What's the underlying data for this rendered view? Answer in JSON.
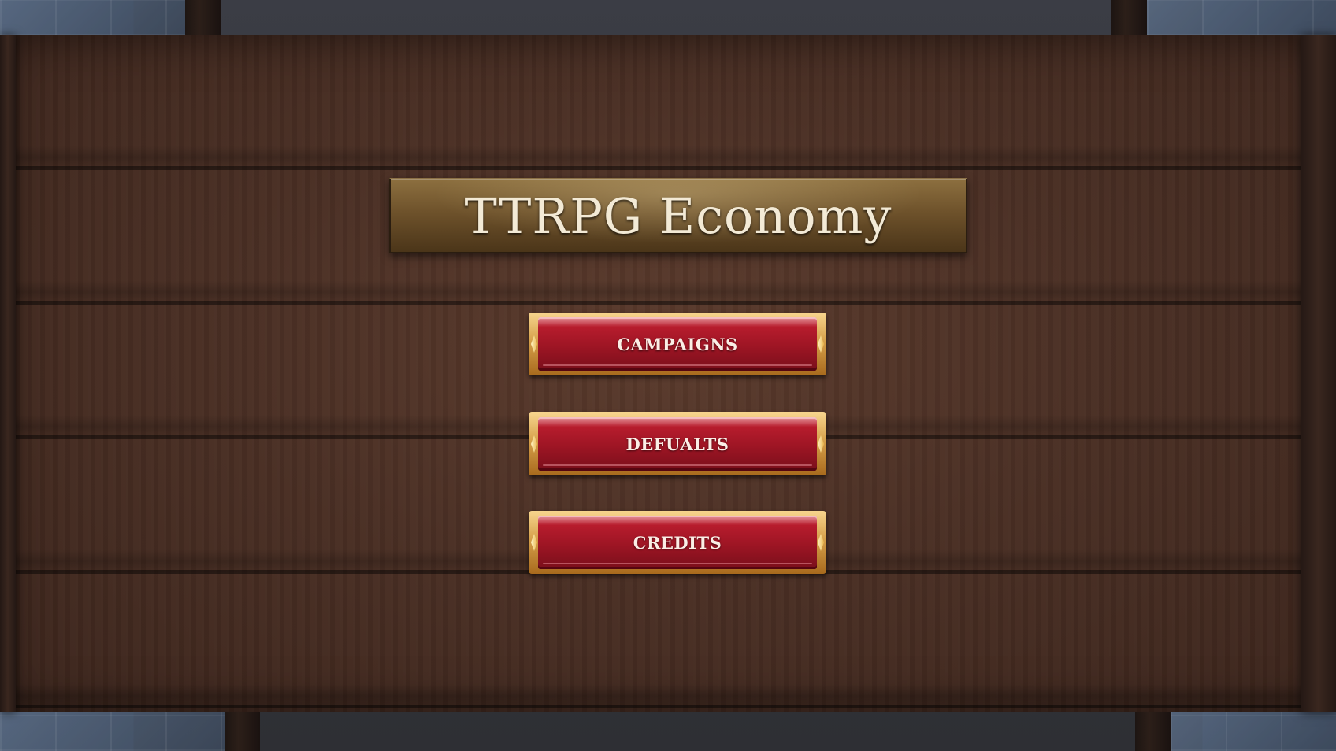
{
  "title": "TTRPG Economy",
  "menu": {
    "campaigns_label": "CAMPAIGNS",
    "defaults_label": "DEFUALTS",
    "credits_label": "CREDITS"
  },
  "colors": {
    "button_red": "#9d1524",
    "button_gold": "#d6a04a",
    "plaque_bronze": "#6e522b",
    "wood": "#4a2f24",
    "title_text": "#f3ead6"
  },
  "icons": [
    "diamond-ornament-icon"
  ]
}
